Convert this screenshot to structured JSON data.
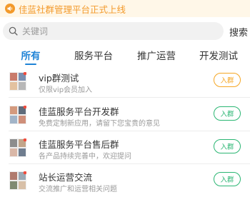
{
  "notice": {
    "text": "佳蓝社群管理平台正式上线",
    "icon": "speaker-icon"
  },
  "search": {
    "placeholder": "关键词",
    "button_label": "搜索",
    "icon": "search-icon"
  },
  "tabs": [
    {
      "label": "所有",
      "active": true
    },
    {
      "label": "服务平台",
      "active": false
    },
    {
      "label": "推广运营",
      "active": false
    },
    {
      "label": "开发测试",
      "active": false
    }
  ],
  "groups": [
    {
      "name": "vip群测试",
      "desc": "仅限vip会员加入",
      "join_label": "入群",
      "join_color": "#f5a623"
    },
    {
      "name": "佳蓝服务平台开发群",
      "desc": "免费定制新应用，请留下您宝贵的意见",
      "join_label": "入群",
      "join_color": "#2bb673"
    },
    {
      "name": "佳蓝服务平台售后群",
      "desc": "各产品持续完善中，欢迎提问",
      "join_label": "入群",
      "join_color": "#2bb673"
    },
    {
      "name": "站长运营交流",
      "desc": "交流推广和运营相关问题",
      "join_label": "入群",
      "join_color": "#2bb673"
    }
  ],
  "colors": {
    "accent": "#1e83d6",
    "notice": "#f39a2b",
    "green": "#2bb673",
    "orange": "#f5a623"
  }
}
